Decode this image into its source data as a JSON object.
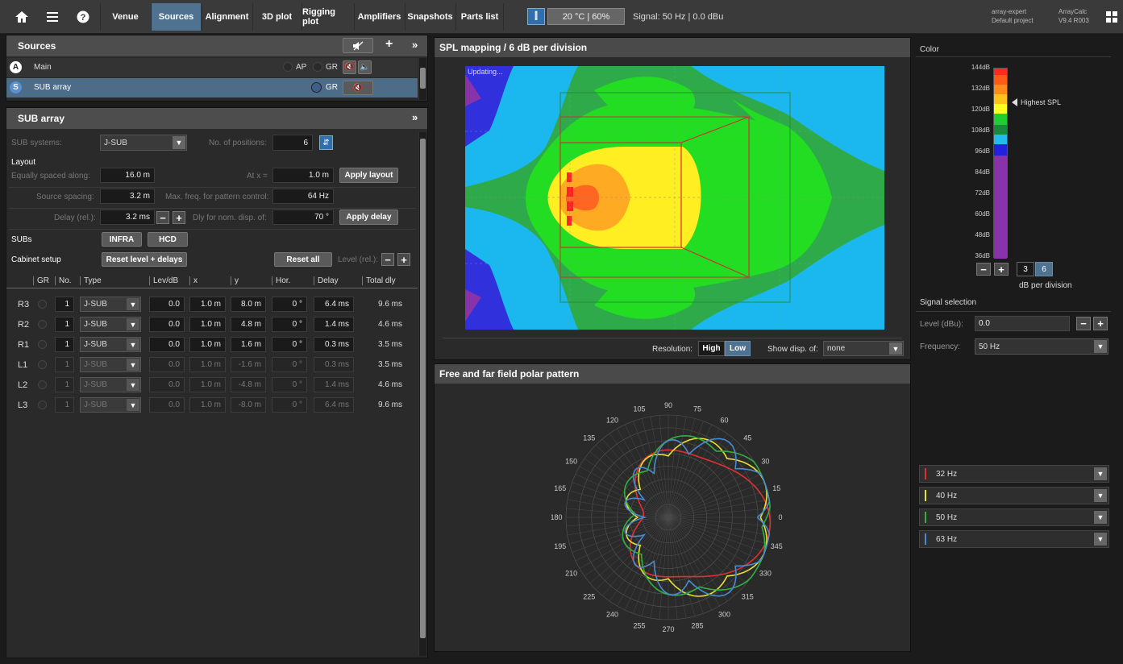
{
  "toolbar": {
    "home_icon": "home-icon",
    "menu_icon": "menu-icon",
    "help_icon": "help-icon",
    "tabs": [
      "Venue",
      "Sources",
      "Alignment",
      "3D plot",
      "Rigging plot",
      "Amplifiers",
      "Snapshots",
      "Parts list"
    ],
    "active_tab": "Sources",
    "temperature": "20 °C | 60%",
    "signal": "Signal: 50 Hz | 0.0 dBu",
    "project_line1": "array-expert",
    "project_line2": "Default project",
    "app_name": "ArrayCalc",
    "version": "V9.4 R003"
  },
  "sources": {
    "title": "Sources",
    "add": "+",
    "collapse": "»",
    "items": [
      {
        "badge": "A",
        "name": "Main",
        "ap": "AP",
        "gr": "GR"
      },
      {
        "badge": "S",
        "name": "SUB array",
        "gr": "GR"
      }
    ]
  },
  "sub": {
    "title": "SUB array",
    "collapse": "»",
    "systems_label": "SUB systems:",
    "systems_value": "J-SUB",
    "positions_label": "No. of positions:",
    "positions_value": "6",
    "layout_label": "Layout",
    "spaced_label": "Equally spaced along:",
    "spaced_value": "16.0 m",
    "atx_label": "At x =",
    "atx_value": "1.0 m",
    "apply_layout": "Apply layout",
    "spacing_label": "Source spacing:",
    "spacing_value": "3.2 m",
    "maxfreq_label": "Max. freq. for pattern control:",
    "maxfreq_value": "64 Hz",
    "delay_label": "Delay (rel.):",
    "delay_value": "3.2 ms",
    "dly_label": "Dly for nom. disp. of:",
    "dly_value": "70 °",
    "apply_delay": "Apply delay",
    "subs_label": "SUBs",
    "infra": "INFRA",
    "hcd": "HCD",
    "cabinet_label": "Cabinet setup",
    "reset_level": "Reset level + delays",
    "reset_all": "Reset all",
    "level_label": "Level (rel.):",
    "columns": [
      "GR",
      "No.",
      "Type",
      "Lev/dB",
      "x",
      "y",
      "Hor.",
      "Delay",
      "Total dly"
    ],
    "rows": [
      {
        "name": "R3",
        "no": "1",
        "type": "J-SUB",
        "lev": "0.0",
        "x": "1.0 m",
        "y": "8.0 m",
        "hor": "0 °",
        "delay": "6.4 ms",
        "total": "9.6 ms",
        "dim": false
      },
      {
        "name": "R2",
        "no": "1",
        "type": "J-SUB",
        "lev": "0.0",
        "x": "1.0 m",
        "y": "4.8 m",
        "hor": "0 °",
        "delay": "1.4 ms",
        "total": "4.6 ms",
        "dim": false
      },
      {
        "name": "R1",
        "no": "1",
        "type": "J-SUB",
        "lev": "0.0",
        "x": "1.0 m",
        "y": "1.6 m",
        "hor": "0 °",
        "delay": "0.3 ms",
        "total": "3.5 ms",
        "dim": false
      },
      {
        "name": "L1",
        "no": "1",
        "type": "J-SUB",
        "lev": "0.0",
        "x": "1.0 m",
        "y": "-1.6 m",
        "hor": "0 °",
        "delay": "0.3 ms",
        "total": "3.5 ms",
        "dim": true
      },
      {
        "name": "L2",
        "no": "1",
        "type": "J-SUB",
        "lev": "0.0",
        "x": "1.0 m",
        "y": "-4.8 m",
        "hor": "0 °",
        "delay": "1.4 ms",
        "total": "4.6 ms",
        "dim": true
      },
      {
        "name": "L3",
        "no": "1",
        "type": "J-SUB",
        "lev": "0.0",
        "x": "1.0 m",
        "y": "-8.0 m",
        "hor": "0 °",
        "delay": "6.4 ms",
        "total": "9.6 ms",
        "dim": true
      }
    ]
  },
  "spl": {
    "title": "SPL mapping / 6 dB per division",
    "updating": "Updating...",
    "resolution_label": "Resolution:",
    "high": "High",
    "low": "Low",
    "show_label": "Show disp. of:",
    "show_value": "none"
  },
  "polar": {
    "title": "Free and far field polar pattern",
    "angles": [
      "90",
      "75",
      "60",
      "45",
      "30",
      "15",
      "0",
      "345",
      "330",
      "315",
      "300",
      "285",
      "270",
      "255",
      "240",
      "225",
      "210",
      "195",
      "180",
      "165",
      "150",
      "135",
      "120",
      "105"
    ]
  },
  "color": {
    "title": "Color",
    "scale": [
      "144dB",
      "132dB",
      "120dB",
      "108dB",
      "96dB",
      "84dB",
      "72dB",
      "60dB",
      "48dB",
      "36dB"
    ],
    "highest": "Highest SPL",
    "div_a": "3",
    "div_b": "6",
    "per_div": "dB per division",
    "bands": [
      "#ff2a1a",
      "#ff5a1a",
      "#ff8c1a",
      "#ffc21a",
      "#ffff22",
      "#22cc33",
      "#1a8a3a",
      "#22bbee",
      "#2222dd",
      "#8833aa"
    ]
  },
  "signal": {
    "title": "Signal selection",
    "level_label": "Level (dBu):",
    "level_value": "0.0",
    "freq_label": "Frequency:",
    "freq_value": "50 Hz"
  },
  "freqs": [
    {
      "label": "32 Hz",
      "color": "#e03030"
    },
    {
      "label": "40 Hz",
      "color": "#e8e030"
    },
    {
      "label": "50 Hz",
      "color": "#30b040"
    },
    {
      "label": "63 Hz",
      "color": "#4a8ad0"
    }
  ]
}
